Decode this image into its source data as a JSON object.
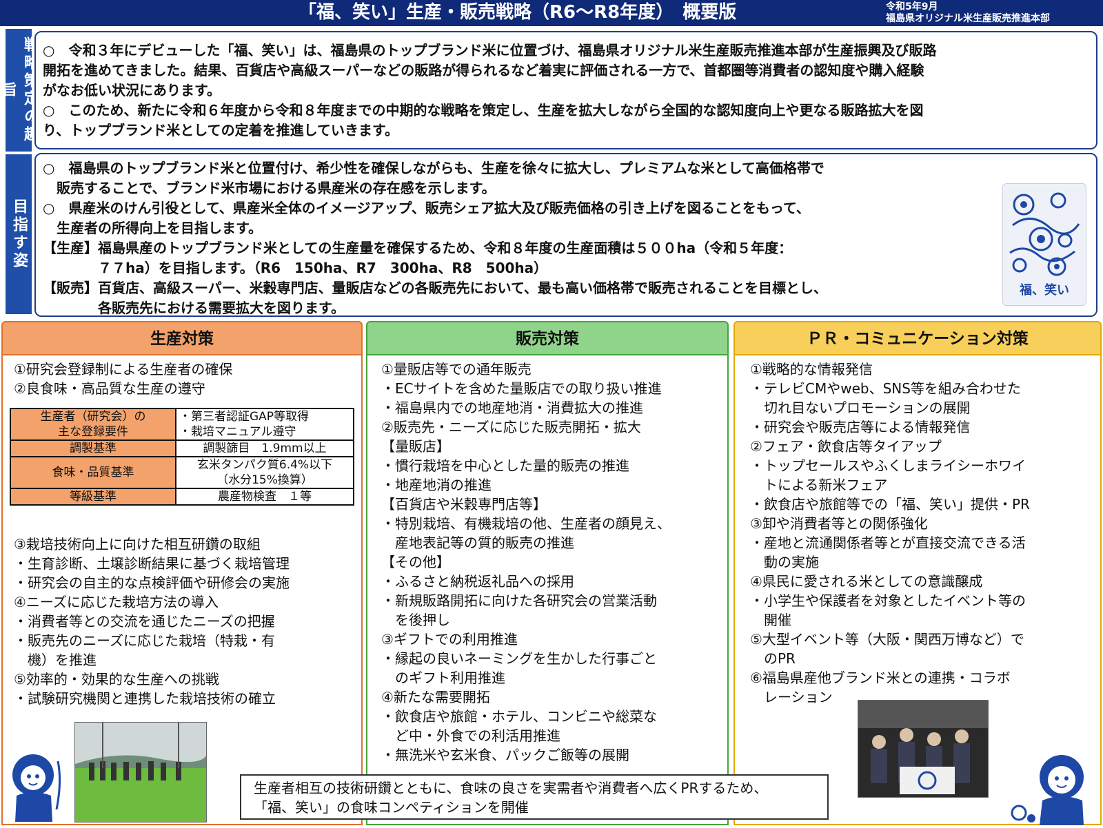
{
  "header": {
    "title": "「福、笑い」生産・販売戦略（R6〜R8年度）　概要版",
    "date": "令和5年9月",
    "org": "福島県オリジナル米生産販売推進本部"
  },
  "purpose": {
    "label": "戦略策定の趣旨",
    "lines": [
      "○　令和３年にデビューした「福、笑い」は、福島県のトップブランド米に位置づけ、福島県オリジナル米生産販売推進本部が生産振興及び販路",
      "開拓を進めてきました。結果、百貨店や高級スーパーなどの販路が得られるなど着実に評価される一方で、首都圏等消費者の認知度や購入経験",
      "がなお低い状況にあります。",
      "○　このため、新たに令和６年度から令和８年度までの中期的な戦略を策定し、生産を拡大しながら全国的な認知度向上や更なる販路拡大を図",
      "り、トップブランド米としての定着を推進していきます。"
    ]
  },
  "goal": {
    "label": "目指す姿",
    "lines": [
      "○　福島県のトップブランド米と位置付け、希少性を確保しながらも、生産を徐々に拡大し、プレミアムな米として高価格帯で",
      "　販売することで、ブランド米市場における県産米の存在感を示します。",
      "○　県産米のけん引役として、県産米全体のイメージアップ、販売シェア拡大及び販売価格の引き上げを図ることをもって、",
      "　生産者の所得向上を目指します。",
      "【生産】福島県産のトップブランド米としての生産量を確保するため、令和８年度の生産面積は５００ha（令和５年度：",
      "　　　　７７ha）を目指します。（R6　150ha、R7　300ha、R8　500ha）",
      "【販売】百貨店、高級スーパー、米穀専門店、量販店などの各販売先において、最も高い価格帯で販売されることを目標とし、",
      "　　　　各販売先における需要拡大を図ります。"
    ],
    "bag_label": "福、笑い"
  },
  "production": {
    "title": "生産対策",
    "top_items": [
      "①研究会登録制による生産者の確保",
      "②良食味・高品質な生産の遵守"
    ],
    "table": [
      {
        "key": "生産者（研究会）の\n主な登録要件",
        "val": "・第三者認証GAP等取得\n・栽培マニュアル遵守"
      },
      {
        "key": "調製基準",
        "val": "調製篩目　1.9mm以上"
      },
      {
        "key": "食味・品質基準",
        "val": "玄米タンパク質6.4%以下\n（水分15%換算）"
      },
      {
        "key": "等級基準",
        "val": "農産物検査　１等"
      }
    ],
    "bottom_items": [
      "③栽培技術向上に向けた相互研鑽の取組",
      "・生育診断、土壌診断結果に基づく栽培管理",
      "・研究会の自主的な点検評価や研修会の実施",
      "④ニーズに応じた栽培方法の導入",
      "・消費者等との交流を通じたニーズの把握",
      "・販売先のニーズに応じた栽培（特栽・有",
      "　機）を推進",
      "⑤効率的・効果的な生産への挑戦",
      "・試験研究機関と連携した栽培技術の確立"
    ]
  },
  "sales": {
    "title": "販売対策",
    "items": [
      "①量販店等での通年販売",
      "・ECサイトを含めた量販店での取り扱い推進",
      "・福島県内での地産地消・消費拡大の推進",
      "②販売先・ニーズに応じた販売開拓・拡大",
      "【量販店】",
      "・慣行栽培を中心とした量的販売の推進",
      "・地産地消の推進",
      "【百貨店や米穀専門店等】",
      "・特別栽培、有機栽培の他、生産者の顔見え、",
      "　産地表記等の質的販売の推進",
      "【その他】",
      "・ふるさと納税返礼品への採用",
      "・新規販路開拓に向けた各研究会の営業活動",
      "　を後押し",
      "③ギフトでの利用推進",
      "・縁起の良いネーミングを生かした行事ごと",
      "　のギフト利用推進",
      "④新たな需要開拓",
      "・飲食店や旅館・ホテル、コンビニや総菜な",
      "　ど中・外食での利活用推進",
      "・無洗米や玄米食、パックご飯等の展開"
    ]
  },
  "pr": {
    "title": "ＰＲ・コミュニケーション対策",
    "items": [
      "①戦略的な情報発信",
      "・テレビCMやweb、SNS等を組み合わせた",
      "　切れ目ないプロモーションの展開",
      "・研究会や販売店等による情報発信",
      "②フェア・飲食店等タイアップ",
      "・トップセールスやふくしまライシーホワイ",
      "　トによる新米フェア",
      "・飲食店や旅館等での「福、笑い」提供・PR",
      "③卸や消費者等との関係強化",
      "・産地と流通関係者等とが直接交流できる活",
      "　動の実施",
      "④県民に愛される米としての意識醸成",
      "・小学生や保護者を対象としたイベント等の",
      "　開催",
      "⑤大型イベント等（大阪・関西万博など）で",
      "　のPR",
      "⑥福島県産他ブランド米との連携・コラボ",
      "　レーション"
    ]
  },
  "note": {
    "lines": [
      "生産者相互の技術研鑽とともに、食味の良さを実需者や消費者へ広くPRするため、",
      "「福、笑い」の食味コンペティションを開催"
    ]
  },
  "colors": {
    "navy": "#0f2a78",
    "label_blue": "#1f4fa8",
    "production": "#f4a26b",
    "sales": "#8fd48a",
    "pr": "#f7cf5a"
  }
}
